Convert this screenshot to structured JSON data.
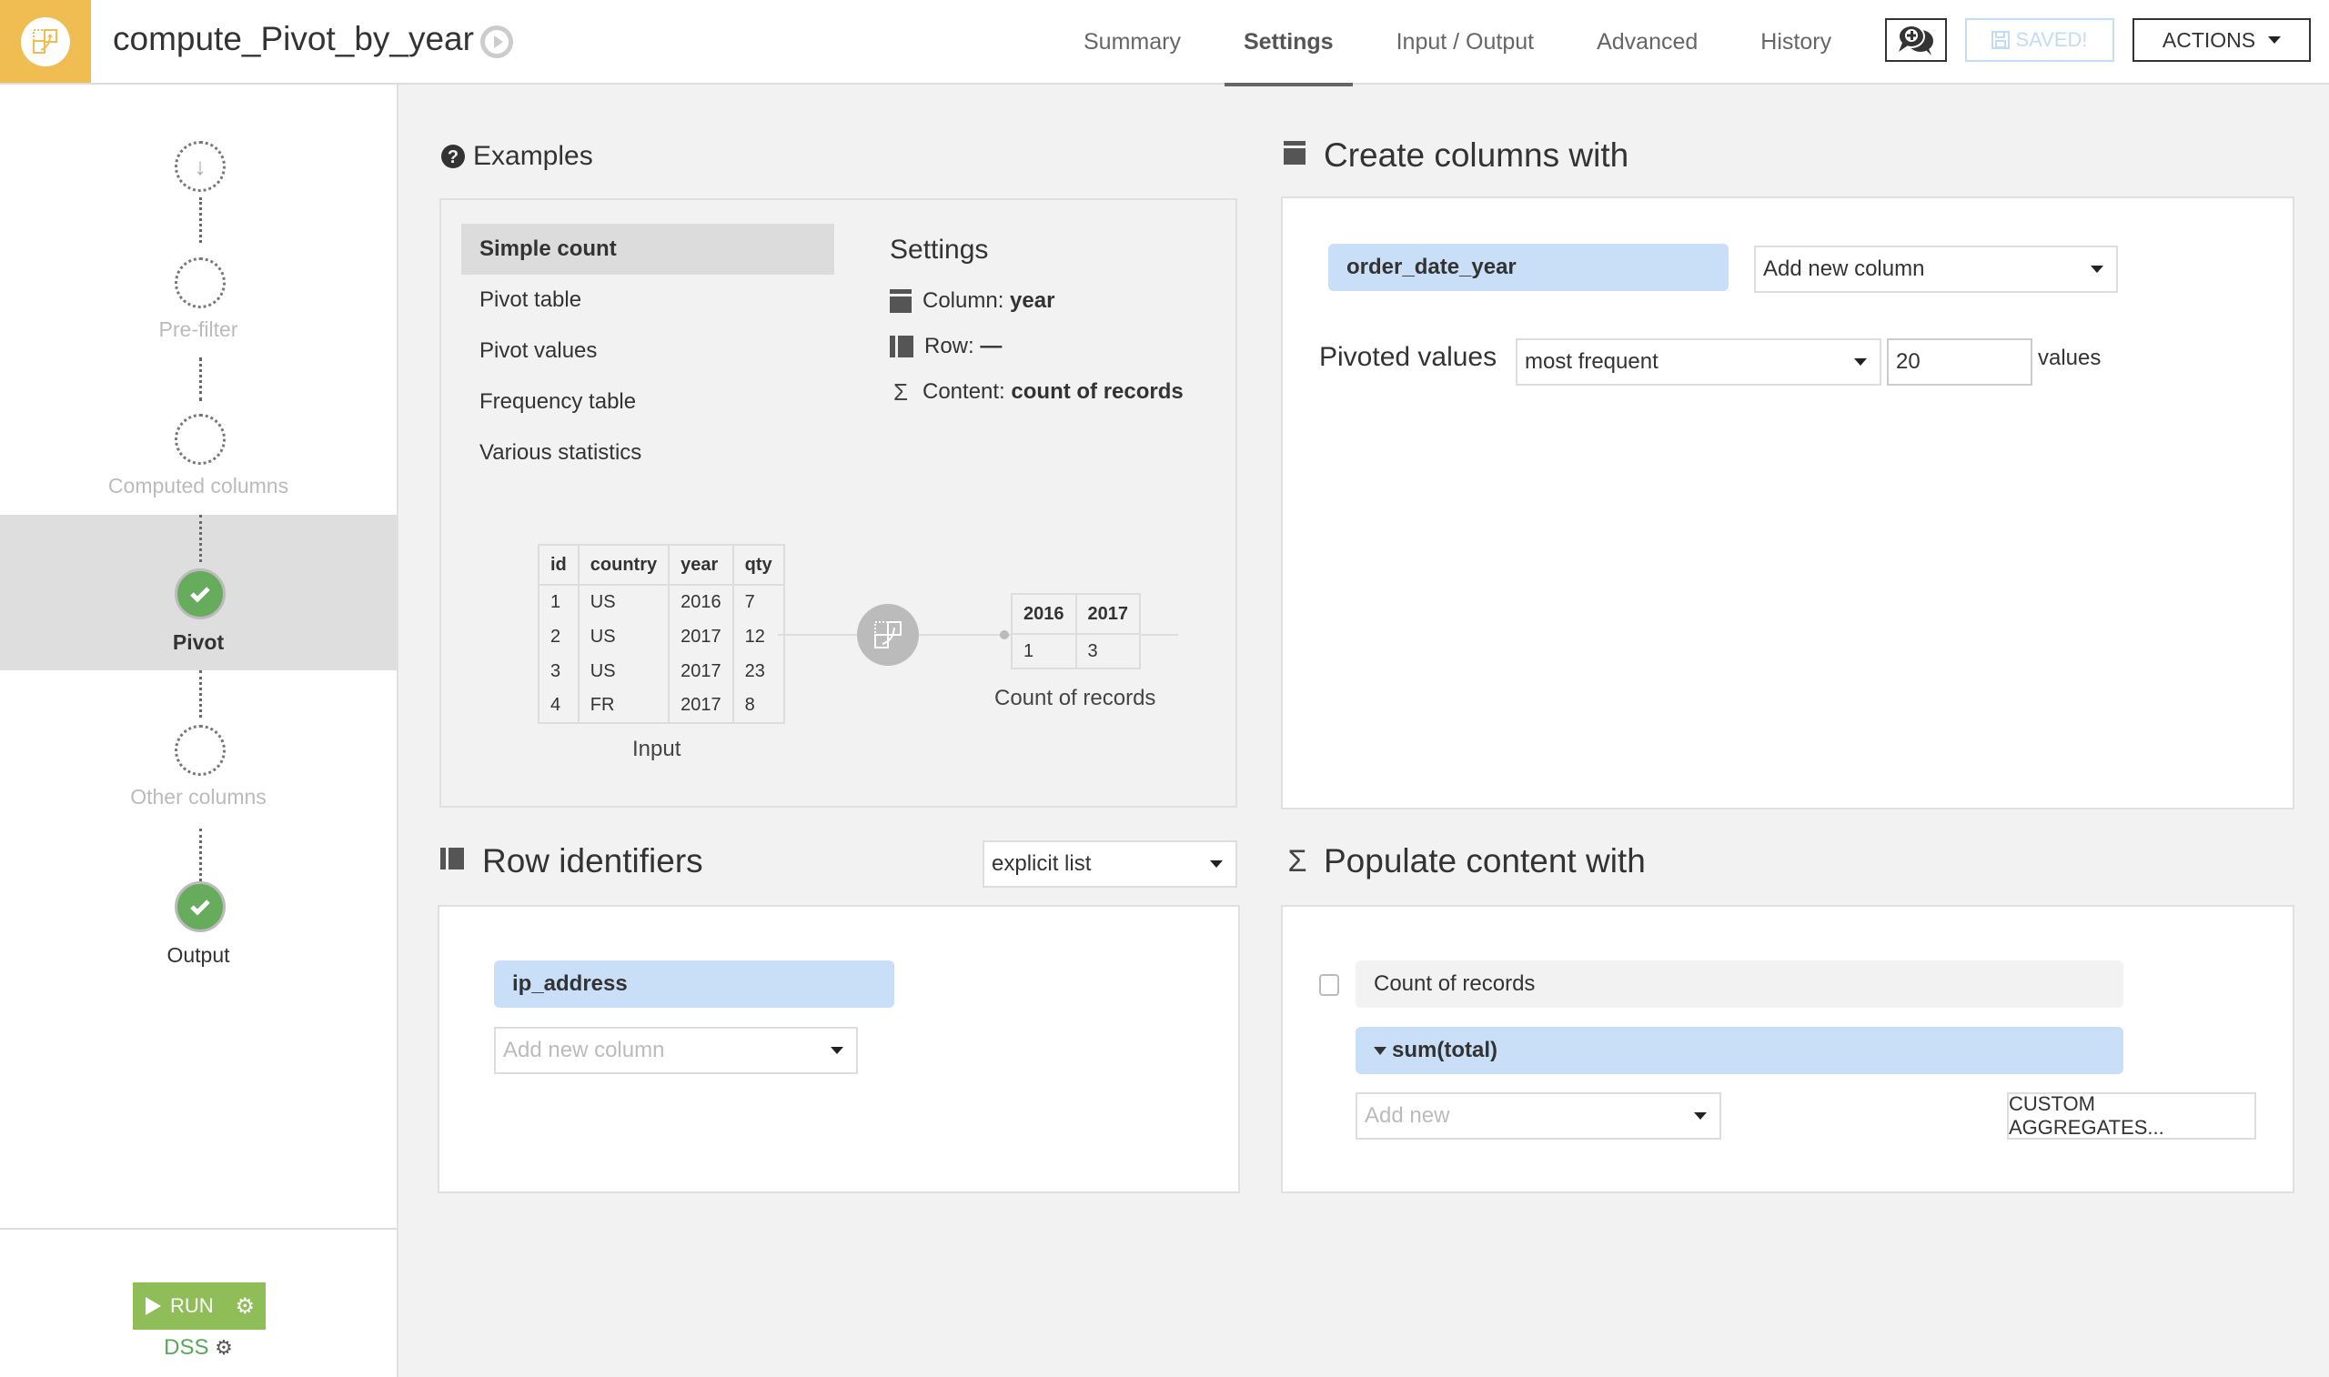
{
  "header": {
    "title": "compute_Pivot_by_year",
    "tabs": [
      {
        "label": "Summary",
        "active": false
      },
      {
        "label": "Settings",
        "active": true
      },
      {
        "label": "Input / Output",
        "active": false
      },
      {
        "label": "Advanced",
        "active": false
      },
      {
        "label": "History",
        "active": false
      }
    ],
    "saved_label": "SAVED!",
    "actions_label": "ACTIONS",
    "brand_color": "#f0bd52"
  },
  "sidebar": {
    "steps": [
      {
        "label": "",
        "icon": "arrow-down",
        "state": "empty"
      },
      {
        "label": "Pre-filter",
        "state": "empty"
      },
      {
        "label": "Computed columns",
        "state": "empty"
      },
      {
        "label": "Pivot",
        "state": "done",
        "selected": true
      },
      {
        "label": "Other columns",
        "state": "empty"
      },
      {
        "label": "Output",
        "state": "done"
      }
    ],
    "run_label": "RUN",
    "engine_label": "DSS"
  },
  "examples": {
    "title": "Examples",
    "items": [
      "Simple count",
      "Pivot table",
      "Pivot values",
      "Frequency table",
      "Various statistics"
    ],
    "active_index": 0,
    "settings": {
      "title": "Settings",
      "column_label": "Column:",
      "column_value": "year",
      "row_label": "Row:",
      "row_value": "—",
      "content_label": "Content:",
      "content_value": "count of records"
    },
    "input_table": {
      "headers": [
        "id",
        "country",
        "year",
        "qty"
      ],
      "rows": [
        [
          "1",
          "US",
          "2016",
          "7"
        ],
        [
          "2",
          "US",
          "2017",
          "12"
        ],
        [
          "3",
          "US",
          "2017",
          "23"
        ],
        [
          "4",
          "FR",
          "2017",
          "8"
        ]
      ],
      "caption": "Input"
    },
    "output_table": {
      "headers": [
        "2016",
        "2017"
      ],
      "rows": [
        [
          "1",
          "3"
        ]
      ],
      "caption": "Count of records"
    }
  },
  "create_columns": {
    "title": "Create columns with",
    "column_chip": "order_date_year",
    "add_column_select": "Add new column",
    "pivoted_values_label": "Pivoted values",
    "pivoted_mode": "most frequent",
    "pivoted_count": "20",
    "values_suffix": "values"
  },
  "row_identifiers": {
    "title": "Row identifiers",
    "mode": "explicit list",
    "chips": [
      "ip_address"
    ],
    "add_column_placeholder": "Add new column"
  },
  "populate": {
    "title": "Populate content with",
    "count_records_label": "Count of records",
    "count_records_checked": false,
    "aggregates": [
      "sum(total)"
    ],
    "add_new_placeholder": "Add new",
    "custom_aggregates_label": "CUSTOM AGGREGATES..."
  }
}
